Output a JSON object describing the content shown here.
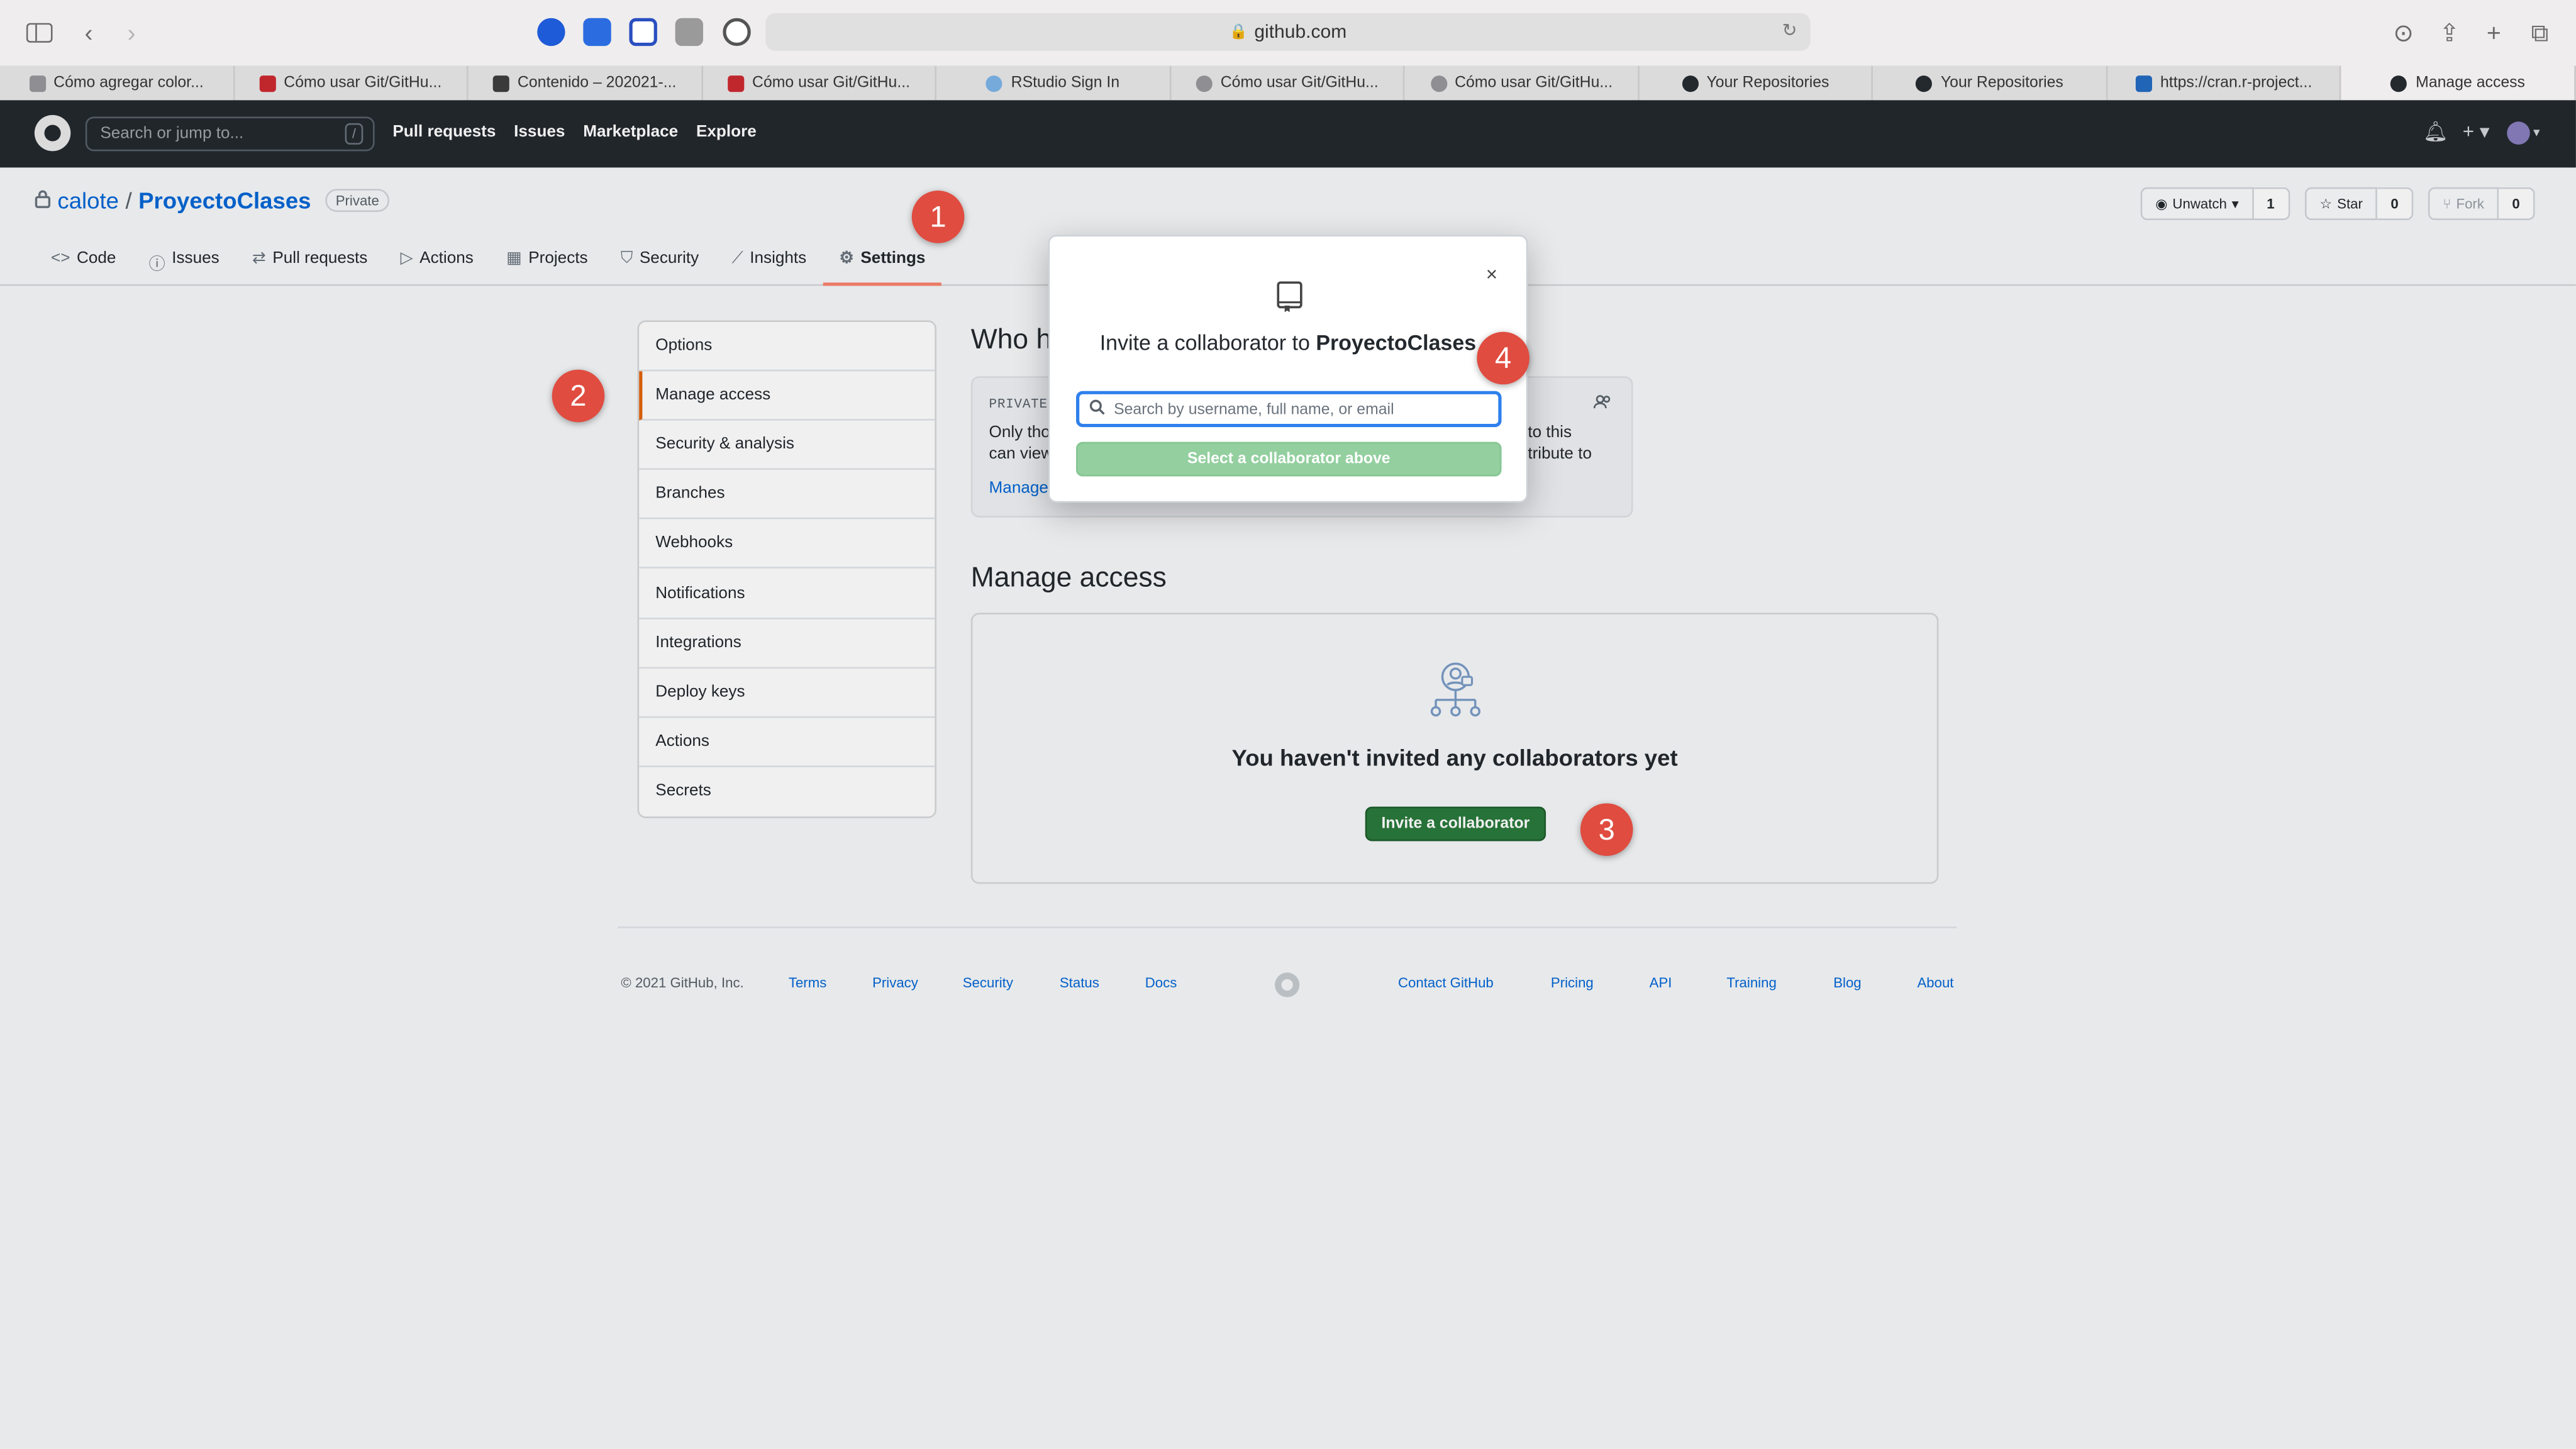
{
  "browser": {
    "url": "github.com",
    "tabs": [
      {
        "label": "Cómo agregar color...",
        "color": "#8e8e93"
      },
      {
        "label": "Cómo usar Git/GitHu...",
        "color": "#c0272d"
      },
      {
        "label": "Contenido – 202021-...",
        "color": "#3a3a3a"
      },
      {
        "label": "Cómo usar Git/GitHu...",
        "color": "#c0272d"
      },
      {
        "label": "RStudio Sign In",
        "color": "#75aadb"
      },
      {
        "label": "Cómo usar Git/GitHu...",
        "color": "#8e8e93"
      },
      {
        "label": "Cómo usar Git/GitHu...",
        "color": "#8e8e93"
      },
      {
        "label": "Your Repositories",
        "color": "#24292e"
      },
      {
        "label": "Your Repositories",
        "color": "#24292e"
      },
      {
        "label": "https://cran.r-project...",
        "color": "#2165b6"
      },
      {
        "label": "Manage access",
        "color": "#24292e"
      }
    ]
  },
  "github": {
    "search_placeholder": "Search or jump to...",
    "search_shortcut": "/",
    "nav": [
      "Pull requests",
      "Issues",
      "Marketplace",
      "Explore"
    ]
  },
  "repo": {
    "owner": "calote",
    "separator": "/",
    "name": "ProyectoClases",
    "visibility": "Private",
    "watch_label": "Unwatch",
    "watch_count": "1",
    "star_label": "Star",
    "star_count": "0",
    "fork_label": "Fork",
    "fork_count": "0",
    "tabs": [
      "Code",
      "Issues",
      "Pull requests",
      "Actions",
      "Projects",
      "Security",
      "Insights",
      "Settings"
    ]
  },
  "settings_menu": [
    "Options",
    "Manage access",
    "Security & analysis",
    "Branches",
    "Webhooks",
    "Notifications",
    "Integrations",
    "Deploy keys",
    "Actions",
    "Secrets"
  ],
  "who": {
    "heading": "Who ha",
    "label": "PRIVATE",
    "line1": "Only tho",
    "line2": "can view",
    "line3": "to this",
    "line4": "tribute to",
    "link": "Manage"
  },
  "manage": {
    "heading": "Manage access",
    "empty_text": "You haven't invited any collaborators yet",
    "invite_button": "Invite a collaborator"
  },
  "modal": {
    "title_prefix": "Invite a collaborator to ",
    "title_repo": "ProyectoClases",
    "search_placeholder": "Search by username, full name, or email",
    "search_value": "",
    "select_button": "Select a collaborator above",
    "close_glyph": "×"
  },
  "footer": {
    "copyright": "© 2021 GitHub, Inc.",
    "left_links": [
      "Terms",
      "Privacy",
      "Security",
      "Status",
      "Docs"
    ],
    "right_links": [
      "Contact GitHub",
      "Pricing",
      "API",
      "Training",
      "Blog",
      "About"
    ]
  },
  "steps": [
    "1",
    "2",
    "3",
    "4"
  ],
  "colors": {
    "accent_orange": "#f9826c",
    "primary_green": "#2a7a3c",
    "disabled_green": "#93cf9f",
    "link_blue": "#0366d6",
    "step_red": "#e04c40"
  }
}
